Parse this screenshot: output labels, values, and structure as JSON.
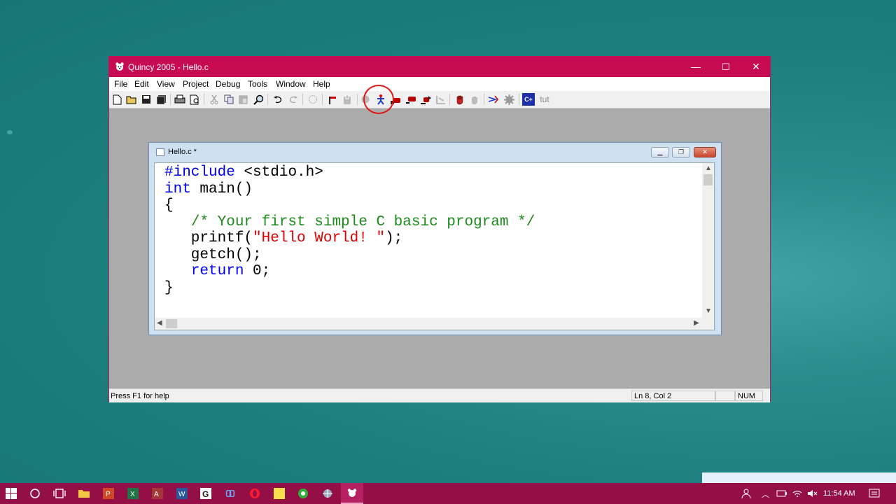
{
  "window": {
    "title": "Quincy 2005 - Hello.c",
    "controls": {
      "minimize": "—",
      "maximize": "☐",
      "close": "✕"
    }
  },
  "menubar": [
    {
      "label": "File"
    },
    {
      "label": "Edit"
    },
    {
      "label": "View"
    },
    {
      "label": "Project"
    },
    {
      "label": "Debug"
    },
    {
      "label": "Tools"
    },
    {
      "label": "Window"
    },
    {
      "label": "Help"
    }
  ],
  "toolbar": {
    "tut_label": "tut",
    "cpp_label": "C+",
    "highlighted_tool": "run-program-icon"
  },
  "child_window": {
    "title": "Hello.c *"
  },
  "editor": {
    "code": [
      "#include <stdio.h>",
      "int main()",
      "{",
      "   /* Your first simple C basic program */",
      "   printf(\"Hello World! \");",
      "   getch();",
      "   return 0;",
      "}"
    ],
    "tokens": {
      "line1_kw": "#include",
      "line1_rest": " <stdio.h>",
      "line2_kw": "int",
      "line2_rest": " main()",
      "line3": "{",
      "line4_indent": "   ",
      "line4_comment": "/* Your first simple C basic program */",
      "line5_a": "   printf(",
      "line5_str": "\"Hello World! \"",
      "line5_b": ");",
      "line6": "   getch();",
      "line7_indent": "   ",
      "line7_kw": "return",
      "line7_rest": " 0;",
      "line8": "}"
    }
  },
  "statusbar": {
    "help": "Press F1 for help",
    "position": "Ln 8, Col 2",
    "num": "NUM"
  },
  "taskbar": {
    "clock": "11:54 AM"
  },
  "colors": {
    "titlebar": "#c70b52",
    "taskbar": "#930f45",
    "keyword": "#0000ff",
    "comment": "#1a8a1a",
    "string": "#e00000"
  }
}
